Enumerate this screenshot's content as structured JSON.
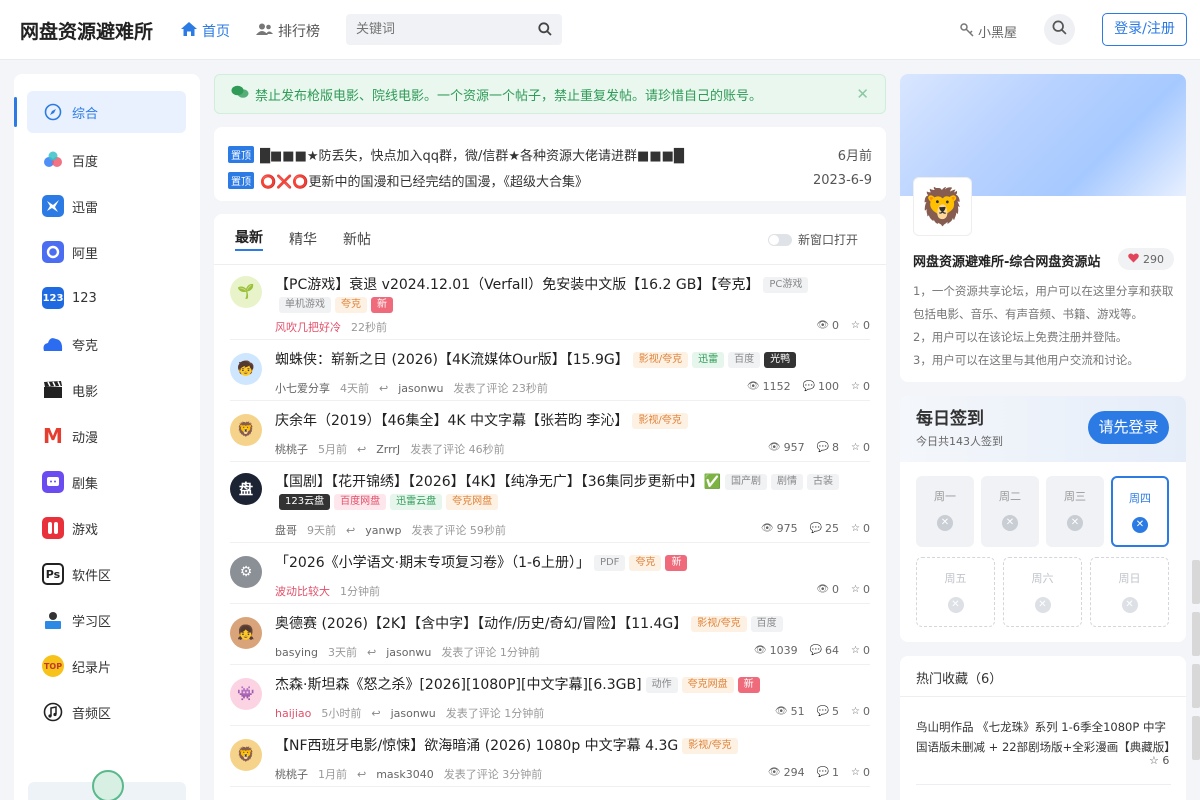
{
  "header": {
    "logo": "网盘资源避难所",
    "nav": [
      {
        "label": "首页",
        "active": true,
        "icon": "home-icon"
      },
      {
        "label": "排行榜",
        "active": false,
        "icon": "users-icon"
      }
    ],
    "search_placeholder": "关键词",
    "room_label": "小黑屋",
    "login_label": "登录/注册"
  },
  "sidebar": {
    "items": [
      {
        "label": "综合",
        "icon": "compass-icon",
        "active": true
      },
      {
        "label": "百度",
        "icon": "baidu-icon"
      },
      {
        "label": "迅雷",
        "icon": "xunlei-icon"
      },
      {
        "label": "阿里",
        "icon": "aliyun-icon"
      },
      {
        "label": "123",
        "icon": "pan123-icon"
      },
      {
        "label": "夸克",
        "icon": "quark-icon"
      },
      {
        "label": "电影",
        "icon": "clapper-icon"
      },
      {
        "label": "动漫",
        "icon": "anime-icon"
      },
      {
        "label": "剧集",
        "icon": "tv-icon"
      },
      {
        "label": "游戏",
        "icon": "gamepad-icon"
      },
      {
        "label": "软件区",
        "icon": "ps-icon"
      },
      {
        "label": "学习区",
        "icon": "study-icon"
      },
      {
        "label": "纪录片",
        "icon": "top-icon"
      },
      {
        "label": "音频区",
        "icon": "music-icon"
      }
    ]
  },
  "notice": {
    "text": "禁止发布枪版电影、院线电影。一个资源一个帖子，禁止重复发帖。请珍惜自己的账号。"
  },
  "pinned": [
    {
      "tag": "置顶",
      "title": "█■■■★防丢失，快点加入qq群，微/信群★各种资源大佬请进群■■■█",
      "date": "6月前"
    },
    {
      "tag": "置顶",
      "title": "⭕❌⭕更新中的国漫和已经完结的国漫，《超级大合集》",
      "date": "2023-6-9"
    }
  ],
  "tabs": {
    "items": [
      "最新",
      "精华",
      "新帖"
    ],
    "new_window": "新窗口打开"
  },
  "posts": [
    {
      "avatar": "sprout",
      "title": "【PC游戏】衰退 v2024.12.01（Verfall）免安装中文版【16.2 GB】【夸克】",
      "badges": [
        [
          "PC游戏",
          ""
        ],
        [
          "单机游戏",
          ""
        ],
        [
          "夸克",
          "orange"
        ],
        [
          "新",
          "red"
        ]
      ],
      "author": "风吹几把好冷",
      "author_red": true,
      "time": "22秒前",
      "replier": "",
      "reply": "",
      "views": "0",
      "comments": "",
      "stars": "0"
    },
    {
      "avatar": "cartoon",
      "title": "蜘蛛侠：崭新之日 (2026)【4K流媒体Our版】【15.9G】",
      "badges": [
        [
          "影视/夸克",
          "orange"
        ],
        [
          "迅雷",
          "green"
        ],
        [
          "百度",
          ""
        ],
        [
          "光鸭",
          "dark"
        ]
      ],
      "author": "小七爱分享",
      "author_red": false,
      "time": "4天前",
      "replier": "jasonwu",
      "reply": "发表了评论 23秒前",
      "views": "1152",
      "comments": "100",
      "stars": "0"
    },
    {
      "avatar": "lion",
      "title": "庆余年（2019）【46集全】4K 中文字幕【张若昀 李沁】",
      "badges": [
        [
          "影视/夸克",
          "orange"
        ]
      ],
      "author": "桃桃子",
      "author_red": false,
      "time": "5月前",
      "replier": "ZrrrJ",
      "reply": "发表了评论 46秒前",
      "views": "957",
      "comments": "8",
      "stars": "0"
    },
    {
      "avatar": "pan",
      "title": "【国剧】【花开锦绣】【2026】【4K】【纯净无广】【36集同步更新中】✅",
      "badges": [
        [
          "国产剧",
          ""
        ],
        [
          "剧情",
          ""
        ],
        [
          "古装",
          ""
        ],
        [
          "123云盘",
          "dark"
        ],
        [
          "百度网盘",
          "pink"
        ],
        [
          "迅雷云盘",
          "green"
        ],
        [
          "夸克网盘",
          "orange"
        ]
      ],
      "author": "盘哥",
      "author_red": false,
      "time": "9天前",
      "replier": "yanwp",
      "reply": "发表了评论 59秒前",
      "views": "975",
      "comments": "25",
      "stars": "0"
    },
    {
      "avatar": "gear",
      "title": "「2026《小学语文·期末专项复习卷》（1-6上册）」",
      "badges": [
        [
          "PDF",
          ""
        ],
        [
          "夸克",
          "orange"
        ],
        [
          "新",
          "red"
        ]
      ],
      "author": "波动比较大",
      "author_red": true,
      "time": "1分钟前",
      "replier": "",
      "reply": "",
      "views": "0",
      "comments": "",
      "stars": "0"
    },
    {
      "avatar": "girl",
      "title": "奥德赛 (2026)【2K】【含中字】【动作/历史/奇幻/冒险】【11.4G】",
      "badges": [
        [
          "影视/夸克",
          "orange"
        ],
        [
          "百度",
          ""
        ]
      ],
      "author": "basying",
      "author_red": false,
      "time": "3天前",
      "replier": "jasonwu",
      "reply": "发表了评论 1分钟前",
      "views": "1039",
      "comments": "64",
      "stars": "0"
    },
    {
      "avatar": "pink",
      "title": "杰森·斯坦森《怒之杀》[2026][1080P][中文字幕][6.3GB]",
      "badges": [
        [
          "动作",
          ""
        ],
        [
          "夸克网盘",
          "orange"
        ],
        [
          "新",
          "red"
        ]
      ],
      "author": "haijiao",
      "author_red": true,
      "time": "5小时前",
      "replier": "jasonwu",
      "reply": "发表了评论 1分钟前",
      "views": "51",
      "comments": "5",
      "stars": "0"
    },
    {
      "avatar": "lion",
      "title": "【NF西班牙电影/惊悚】欲海暗涌 (2026) 1080p 中文字幕 4.3G",
      "badges": [
        [
          "影视/夸克",
          "orange"
        ]
      ],
      "author": "桃桃子",
      "author_red": false,
      "time": "1月前",
      "replier": "mask3040",
      "reply": "发表了评论 3分钟前",
      "views": "294",
      "comments": "1",
      "stars": "0"
    }
  ],
  "profile": {
    "name": "网盘资源避难所-综合网盘资源站",
    "likes": "290",
    "desc": [
      "1，一个资源共享论坛，用户可以在这里分享和获取包括电影、音乐、有声音频、书籍、游戏等。",
      "2，用户可以在该论坛上免费注册并登陆。",
      "3，用户可以在这里与其他用户交流和讨论。"
    ]
  },
  "checkin": {
    "title": "每日签到",
    "sub": "今日共143人签到",
    "button": "请先登录",
    "days": [
      "周一",
      "周二",
      "周三",
      "周四",
      "周五",
      "周六",
      "周日"
    ]
  },
  "favorites": {
    "title": "热门收藏（6）",
    "item": "鸟山明作品 《七龙珠》系列 1-6季全1080P 中字国语版未删减 + 22部剧场版+全彩漫画【典藏版】",
    "stars": "6"
  }
}
